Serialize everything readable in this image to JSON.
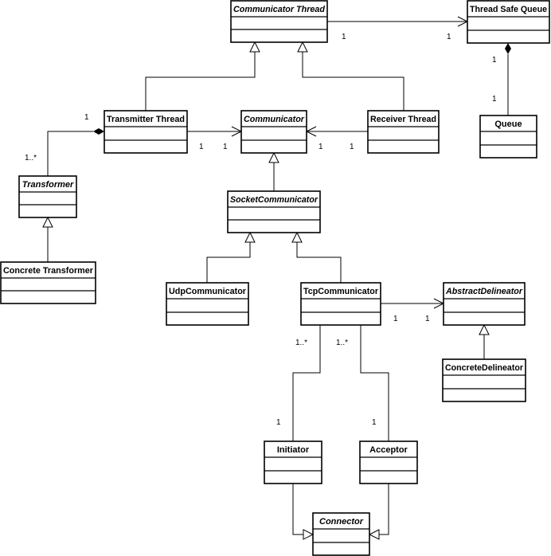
{
  "diagram_type": "UML class diagram",
  "classes": {
    "communicator_thread": {
      "name": "Communicator Thread",
      "abstract": true
    },
    "thread_safe_queue": {
      "name": "Thread Safe Queue",
      "abstract": false
    },
    "queue": {
      "name": "Queue",
      "abstract": false
    },
    "transmitter_thread": {
      "name": "Transmitter Thread",
      "abstract": false
    },
    "communicator": {
      "name": "Communicator",
      "abstract": true
    },
    "receiver_thread": {
      "name": "Receiver Thread",
      "abstract": false
    },
    "transformer": {
      "name": "Transformer",
      "abstract": true
    },
    "concrete_transformer": {
      "name": "Concrete Transformer",
      "abstract": false
    },
    "socket_communicator": {
      "name": "SocketCommunicator",
      "abstract": true
    },
    "udp_communicator": {
      "name": "UdpCommunicator",
      "abstract": false
    },
    "tcp_communicator": {
      "name": "TcpCommunicator",
      "abstract": false
    },
    "abstract_delineator": {
      "name": "AbstractDelineator",
      "abstract": true
    },
    "concrete_delineator": {
      "name": "ConcreteDelineator",
      "abstract": false
    },
    "initiator": {
      "name": "Initiator",
      "abstract": false
    },
    "acceptor": {
      "name": "Acceptor",
      "abstract": false
    },
    "connector": {
      "name": "Connector",
      "abstract": true
    }
  },
  "relationships": {
    "ct_tsq": {
      "type": "association",
      "from": "communicator_thread",
      "to": "thread_safe_queue",
      "from_mult": "1",
      "to_mult": "1"
    },
    "tsq_queue": {
      "type": "composition",
      "from": "thread_safe_queue",
      "to": "queue",
      "from_mult": "1",
      "to_mult": "1"
    },
    "tt_ct": {
      "type": "generalization",
      "from": "transmitter_thread",
      "to": "communicator_thread"
    },
    "rt_ct": {
      "type": "generalization",
      "from": "receiver_thread",
      "to": "communicator_thread"
    },
    "tt_comm": {
      "type": "association",
      "from": "transmitter_thread",
      "to": "communicator",
      "from_mult": "1",
      "to_mult": "1"
    },
    "rt_comm": {
      "type": "association",
      "from": "receiver_thread",
      "to": "communicator",
      "from_mult": "1",
      "to_mult": "1"
    },
    "tt_tr": {
      "type": "composition",
      "from": "transmitter_thread",
      "to": "transformer",
      "from_mult": "1",
      "to_mult": "1..*"
    },
    "ctr_tr": {
      "type": "generalization",
      "from": "concrete_transformer",
      "to": "transformer"
    },
    "sc_comm": {
      "type": "generalization",
      "from": "socket_communicator",
      "to": "communicator"
    },
    "udp_sc": {
      "type": "generalization",
      "from": "udp_communicator",
      "to": "socket_communicator"
    },
    "tcp_sc": {
      "type": "generalization",
      "from": "tcp_communicator",
      "to": "socket_communicator"
    },
    "tcp_ad": {
      "type": "association",
      "from": "tcp_communicator",
      "to": "abstract_delineator",
      "from_mult": "1",
      "to_mult": "1"
    },
    "cd_ad": {
      "type": "generalization",
      "from": "concrete_delineator",
      "to": "abstract_delineator"
    },
    "tcp_init": {
      "type": "association",
      "from": "tcp_communicator",
      "to": "initiator",
      "from_mult": "1..*",
      "to_mult": "1"
    },
    "tcp_acc": {
      "type": "association",
      "from": "tcp_communicator",
      "to": "acceptor",
      "from_mult": "1..*",
      "to_mult": "1"
    },
    "init_conn": {
      "type": "generalization",
      "from": "initiator",
      "to": "connector"
    },
    "acc_conn": {
      "type": "generalization",
      "from": "acceptor",
      "to": "connector"
    }
  }
}
